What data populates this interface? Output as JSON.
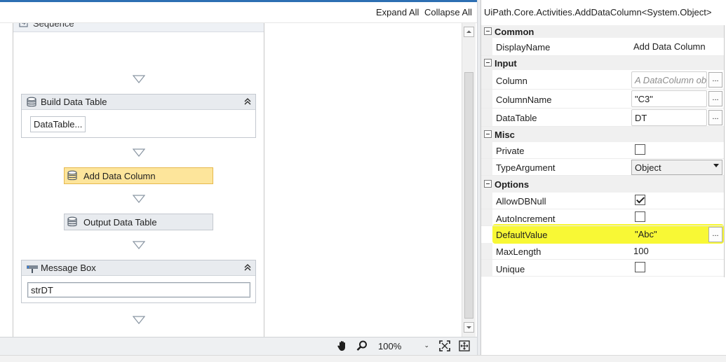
{
  "designer": {
    "toolbar": {
      "expand_all": "Expand All",
      "collapse_all": "Collapse All"
    },
    "sequence": {
      "title": "Sequence"
    },
    "activities": {
      "build_data_table": {
        "title": "Build Data Table",
        "button": "DataTable..."
      },
      "add_data_column": {
        "title": "Add Data Column"
      },
      "output_data_table": {
        "title": "Output Data Table"
      },
      "message_box": {
        "title": "Message Box",
        "text": "strDT"
      }
    }
  },
  "statusbar": {
    "zoom": "100%"
  },
  "properties": {
    "title": "UiPath.Core.Activities.AddDataColumn<System.Object>",
    "categories": {
      "common": "Common",
      "input": "Input",
      "misc": "Misc",
      "options": "Options"
    },
    "rows": {
      "display_name": {
        "name": "DisplayName",
        "value": "Add Data Column"
      },
      "column": {
        "name": "Column",
        "placeholder": "A DataColumn ob"
      },
      "column_name": {
        "name": "ColumnName",
        "value": "\"C3\""
      },
      "data_table": {
        "name": "DataTable",
        "value": "DT"
      },
      "private": {
        "name": "Private",
        "checked": false
      },
      "type_argument": {
        "name": "TypeArgument",
        "value": "Object"
      },
      "allow_db_null": {
        "name": "AllowDBNull",
        "checked": true
      },
      "auto_increment": {
        "name": "AutoIncrement",
        "checked": false
      },
      "default_value": {
        "name": "DefaultValue",
        "value": "\"Abc\""
      },
      "max_length": {
        "name": "MaxLength",
        "value": "100"
      },
      "unique": {
        "name": "Unique",
        "checked": false
      }
    },
    "ellipsis": "...",
    "highlight_color": "#f8f835"
  },
  "colors": {
    "selected_activity": "#fde59b",
    "accent": "#2d6fb3"
  }
}
